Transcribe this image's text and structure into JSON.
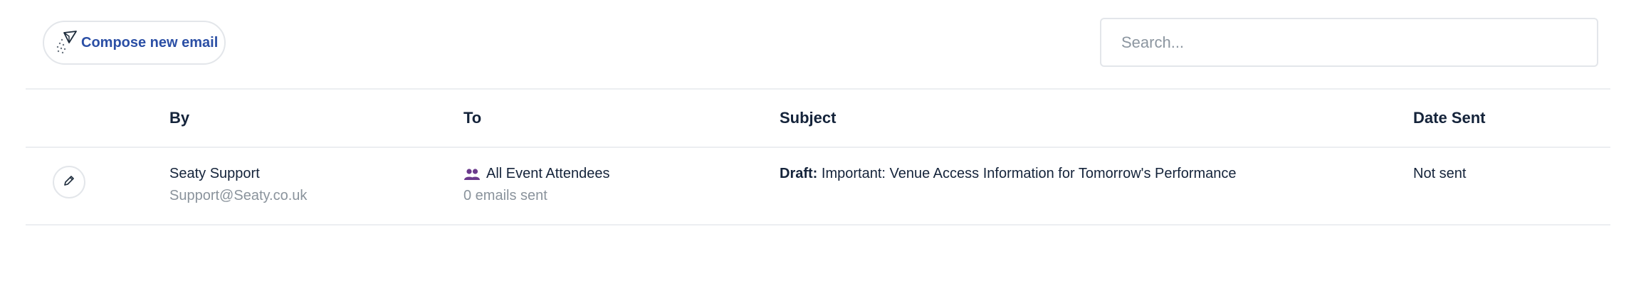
{
  "toolbar": {
    "compose_label": "Compose new email",
    "compose_icon": "paper-plane-icon",
    "search_placeholder": "Search...",
    "search_value": ""
  },
  "table": {
    "columns": [
      "",
      "By",
      "To",
      "Subject",
      "Date Sent"
    ],
    "rows": [
      {
        "action_icon": "pencil-icon",
        "by_name": "Seaty Support",
        "by_email": "Support@Seaty.co.uk",
        "to_icon": "people-icon",
        "to_name": "All Event Attendees",
        "to_count": "0 emails sent",
        "subject_status": "Draft:",
        "subject_text": "Important: Venue Access Information for Tomorrow's Performance",
        "date_sent": "Not sent"
      }
    ]
  },
  "colors": {
    "accent": "#2b4fa5",
    "people_icon": "#6b3a8c",
    "muted_text": "#8a939c",
    "border": "#e3e6ea"
  }
}
